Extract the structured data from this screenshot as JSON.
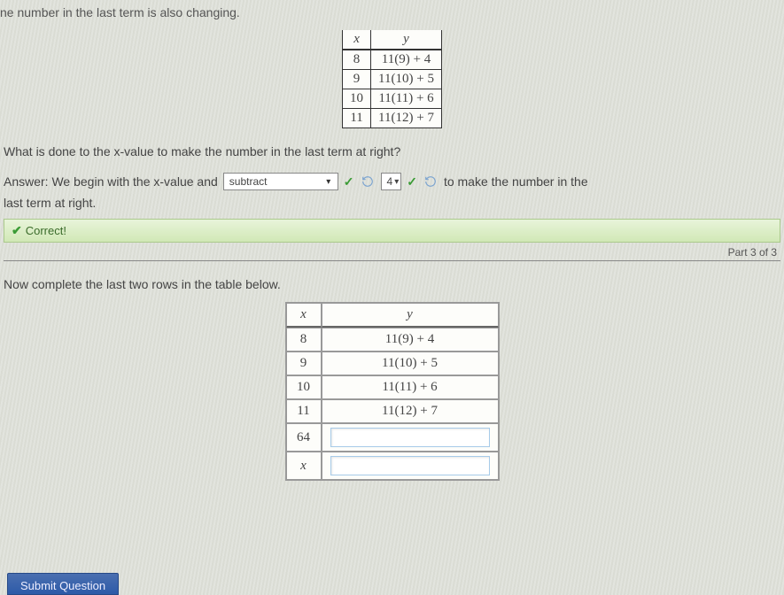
{
  "cut_text": "ne number in the last term is also changing.",
  "table1": {
    "headers": {
      "x": "x",
      "y": "y"
    },
    "rows": [
      {
        "x": "8",
        "y": "11(9) + 4"
      },
      {
        "x": "9",
        "y": "11(10) + 5"
      },
      {
        "x": "10",
        "y": "11(11) + 6"
      },
      {
        "x": "11",
        "y": "11(12) + 7"
      }
    ]
  },
  "question": "What is done to the x-value to make the number in the last term at right?",
  "answer_prefix": "Answer: We begin with the x-value and",
  "dropdown_op": {
    "value": "subtract"
  },
  "num_field": {
    "value": "4"
  },
  "answer_suffix": "to make the number in the",
  "answer_line2": "last term at right.",
  "correct_label": "Correct!",
  "part_label": "Part 3 of 3",
  "prompt2": "Now complete the last two rows in the table below.",
  "table2": {
    "headers": {
      "x": "x",
      "y": "y"
    },
    "rows": [
      {
        "x": "8",
        "y": "11(9) + 4"
      },
      {
        "x": "9",
        "y": "11(10) + 5"
      },
      {
        "x": "10",
        "y": "11(11) + 6"
      },
      {
        "x": "11",
        "y": "11(12) + 7"
      }
    ],
    "input_rows": [
      {
        "x": "64",
        "y": ""
      },
      {
        "x": "x",
        "y": ""
      }
    ]
  },
  "submit_label": "Submit Question"
}
